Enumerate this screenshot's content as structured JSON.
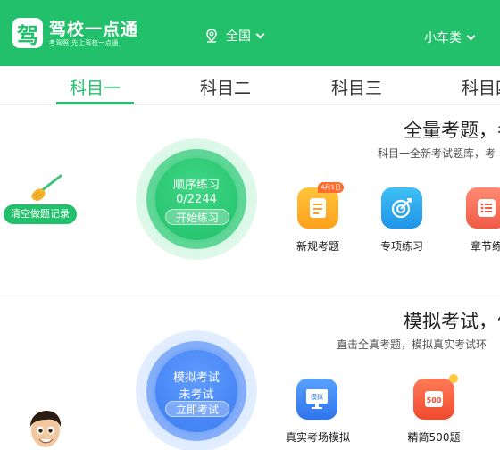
{
  "header": {
    "logo_glyph": "驾",
    "app_name": "驾校一点通",
    "slogan": "考驾照 先上驾校一点通",
    "location": "全国",
    "car_type": "小车类"
  },
  "tabs": [
    "科目一",
    "科目二",
    "科目三",
    "科目四"
  ],
  "section1": {
    "title": "全量考题，考",
    "subtitle": "科目一全新考试题库，考",
    "clear_records": "清空做题记录",
    "circle": {
      "title": "顺序练习",
      "progress": "0/2244",
      "button": "开始练习"
    },
    "features": [
      {
        "label": "新规考题",
        "badge": "4月1日",
        "icon": "document-icon",
        "color": "#ffb022"
      },
      {
        "label": "专项练习",
        "icon": "target-icon",
        "color": "#2aa5ee"
      },
      {
        "label": "章节练",
        "icon": "list-icon",
        "color": "#f26a55"
      }
    ]
  },
  "section2": {
    "title": "模拟考试，仿",
    "subtitle": "直击全真考题，模拟真实考试环",
    "circle": {
      "title": "模拟考试",
      "status": "未考试",
      "button": "立即考试"
    },
    "features": [
      {
        "label": "真实考场模拟",
        "icon_text": "模拟",
        "icon": "monitor-icon",
        "color": "#3f86f2"
      },
      {
        "label": "精简500题",
        "icon_text": "500",
        "icon": "book-500-icon",
        "color": "#f55a3a"
      }
    ]
  },
  "colors": {
    "brand": "#22c06b",
    "blue": "#3b7cf0"
  }
}
